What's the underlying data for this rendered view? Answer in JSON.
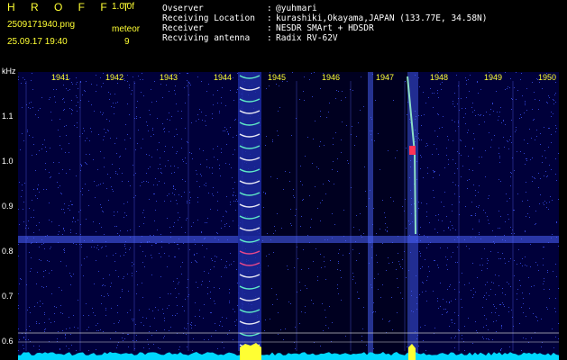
{
  "header": {
    "title": "H R O F F T",
    "version": "1.0.0f",
    "filename": "2509171940.png",
    "datetime": "25.09.17 19:40",
    "meteor_label": "meteor",
    "meteor_count": "9"
  },
  "info": [
    {
      "key": "Ovserver",
      "value": "@yuhmari"
    },
    {
      "key": "Receiving Location",
      "value": "kurashiki,Okayama,JAPAN (133.77E, 34.58N)"
    },
    {
      "key": "Receiver",
      "value": "NESDR SMArt + HDSDR"
    },
    {
      "key": "Recviving antenna",
      "value": "Radix RV-62V"
    }
  ],
  "y_unit": "kHz",
  "y_ticks": [
    "1.1",
    "1.0",
    "0.9",
    "0.8",
    "0.7",
    "0.6"
  ],
  "x_ticks": [
    "1941",
    "1942",
    "1943",
    "1944",
    "1945",
    "1946",
    "1947",
    "1948",
    "1949",
    "1950"
  ],
  "colors": {
    "background": "#00003a",
    "noise": "#3f55ff",
    "label": "#ffff33",
    "baseline": "#00d8ff"
  }
}
